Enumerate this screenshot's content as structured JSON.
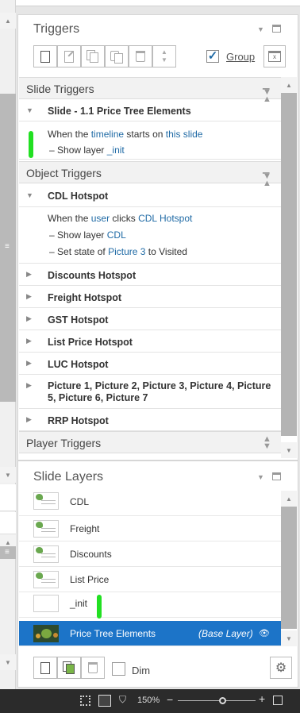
{
  "triggers_panel": {
    "title": "Triggers",
    "group_label": "Group",
    "group_checked": true,
    "toolbar_icons": [
      "new-trigger-icon",
      "edit-trigger-icon",
      "copy-icon",
      "paste-icon",
      "delete-icon",
      "move-up-down-icon"
    ]
  },
  "slide_triggers": {
    "header": "Slide Triggers",
    "slide_name": "Slide - 1.1 Price Tree Elements",
    "trigger": {
      "w1": "When the",
      "event": "timeline",
      "w2": "starts on",
      "object": "this slide",
      "a1": "Show layer",
      "a1_target": "_init"
    }
  },
  "object_triggers": {
    "header": "Object Triggers",
    "expanded_name": "CDL Hotspot",
    "trigger": {
      "w1": "When the",
      "event": "user",
      "w2": "clicks",
      "object": "CDL Hotspot",
      "a1": "Show layer",
      "a1_target": "CDL",
      "a2": "Set state of",
      "a2_target": "Picture 3",
      "a2_to": "to",
      "a2_state": "Visited"
    },
    "collapsed": [
      "Discounts Hotspot",
      "Freight Hotspot",
      "GST Hotspot",
      "List Price Hotspot",
      "LUC Hotspot",
      "Picture 1, Picture 2, Picture 3, Picture 4, Picture 5, Picture 6, Picture 7",
      "RRP Hotspot"
    ]
  },
  "player_triggers": {
    "header": "Player Triggers"
  },
  "layers_panel": {
    "title": "Slide Layers",
    "layers": [
      "CDL",
      "Freight",
      "Discounts",
      "List Price",
      "_init"
    ],
    "base_layer": {
      "name": "Price Tree Elements",
      "tag": "(Base Layer)"
    },
    "dim_label": "Dim",
    "dim_checked": false
  },
  "statusbar": {
    "zoom": "150%"
  },
  "colors": {
    "link": "#1f6aa5",
    "selection": "#1c74c8",
    "green_marker": "#22e022"
  }
}
